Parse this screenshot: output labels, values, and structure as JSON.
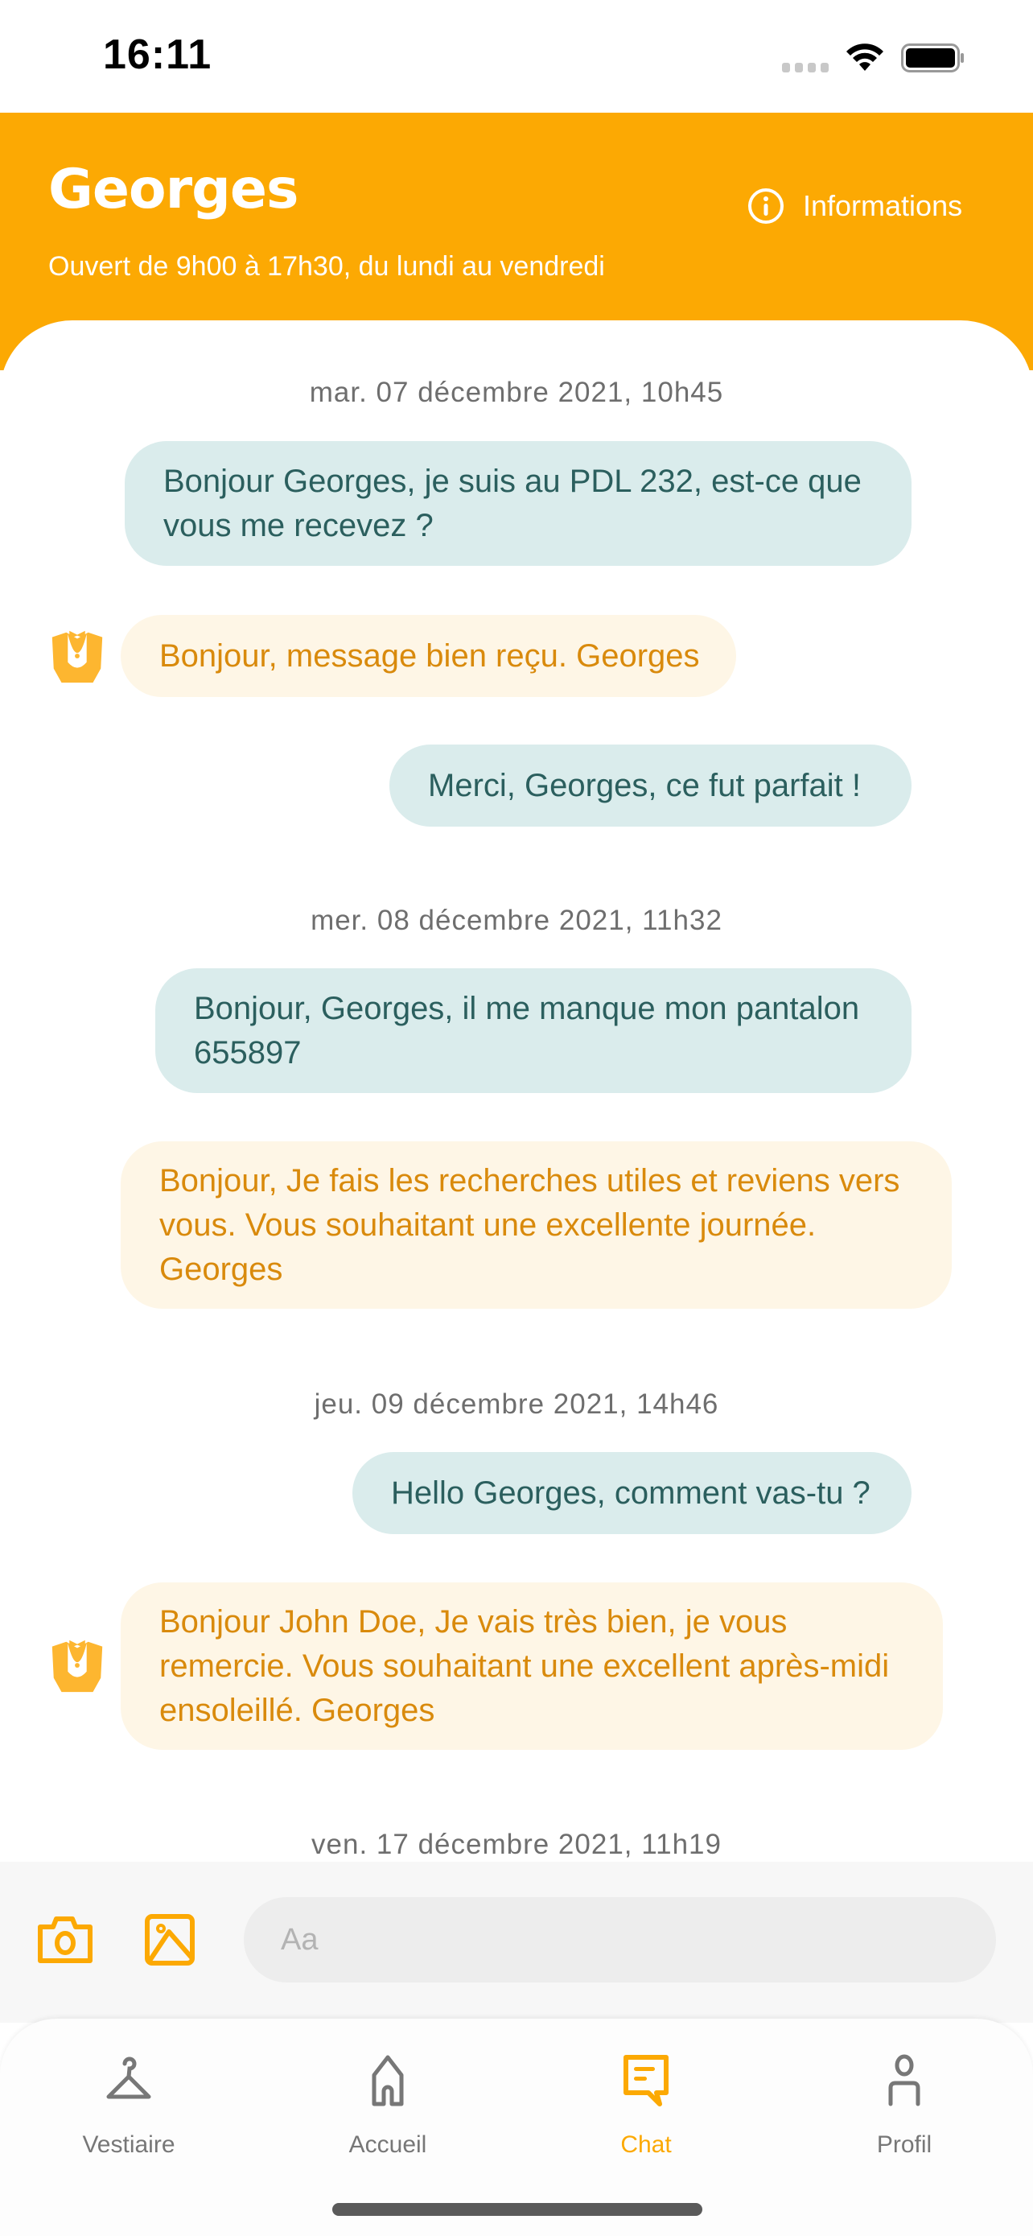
{
  "status_bar": {
    "time": "16:11"
  },
  "header": {
    "title": "Georges",
    "subtitle": "Ouvert de 9h00 à 17h30, du lundi au vendredi",
    "info_label": "Informations",
    "info_icon": "info-circle-icon"
  },
  "conversation": [
    {
      "type": "date",
      "text": "mar. 07 décembre 2021, 10h45"
    },
    {
      "type": "me",
      "text": "Bonjour Georges, je suis au PDL 232, est-ce que vous me recevez ?"
    },
    {
      "type": "bot",
      "text": "Bonjour, message bien reçu. Georges",
      "avatar": "butler-icon"
    },
    {
      "type": "me",
      "text": "Merci, Georges, ce fut parfait !"
    },
    {
      "type": "date",
      "text": "mer. 08 décembre 2021, 11h32"
    },
    {
      "type": "me",
      "text": "Bonjour, Georges, il me manque mon pantalon 655897"
    },
    {
      "type": "bot",
      "text": "Bonjour, Je fais les recherches utiles et reviens vers vous. Vous souhaitant une excellente journée. Georges"
    },
    {
      "type": "date",
      "text": "jeu. 09 décembre 2021, 14h46"
    },
    {
      "type": "me",
      "text": "Hello Georges, comment vas-tu ?"
    },
    {
      "type": "bot",
      "text": "Bonjour John Doe, Je vais très bien, je vous remercie. Vous souhaitant une excellent après-midi ensoleillé. Georges",
      "avatar": "butler-icon"
    },
    {
      "type": "date",
      "text": "ven. 17 décembre 2021, 11h19"
    }
  ],
  "composer": {
    "placeholder": "Aa",
    "value": "",
    "camera_icon": "camera-icon",
    "gallery_icon": "image-icon"
  },
  "tabs": [
    {
      "label": "Vestiaire",
      "icon": "hanger-icon",
      "active": false
    },
    {
      "label": "Accueil",
      "icon": "home-icon",
      "active": false
    },
    {
      "label": "Chat",
      "icon": "chat-icon",
      "active": true
    },
    {
      "label": "Profil",
      "icon": "user-icon",
      "active": false
    }
  ],
  "colors": {
    "accent": "#FCA903",
    "me_bubble_bg": "#DAECEC",
    "me_bubble_text": "#2B5F5E",
    "bot_bubble_bg": "#FEF6E6",
    "bot_bubble_text": "#D98A0C",
    "inactive_tab": "#777777"
  }
}
